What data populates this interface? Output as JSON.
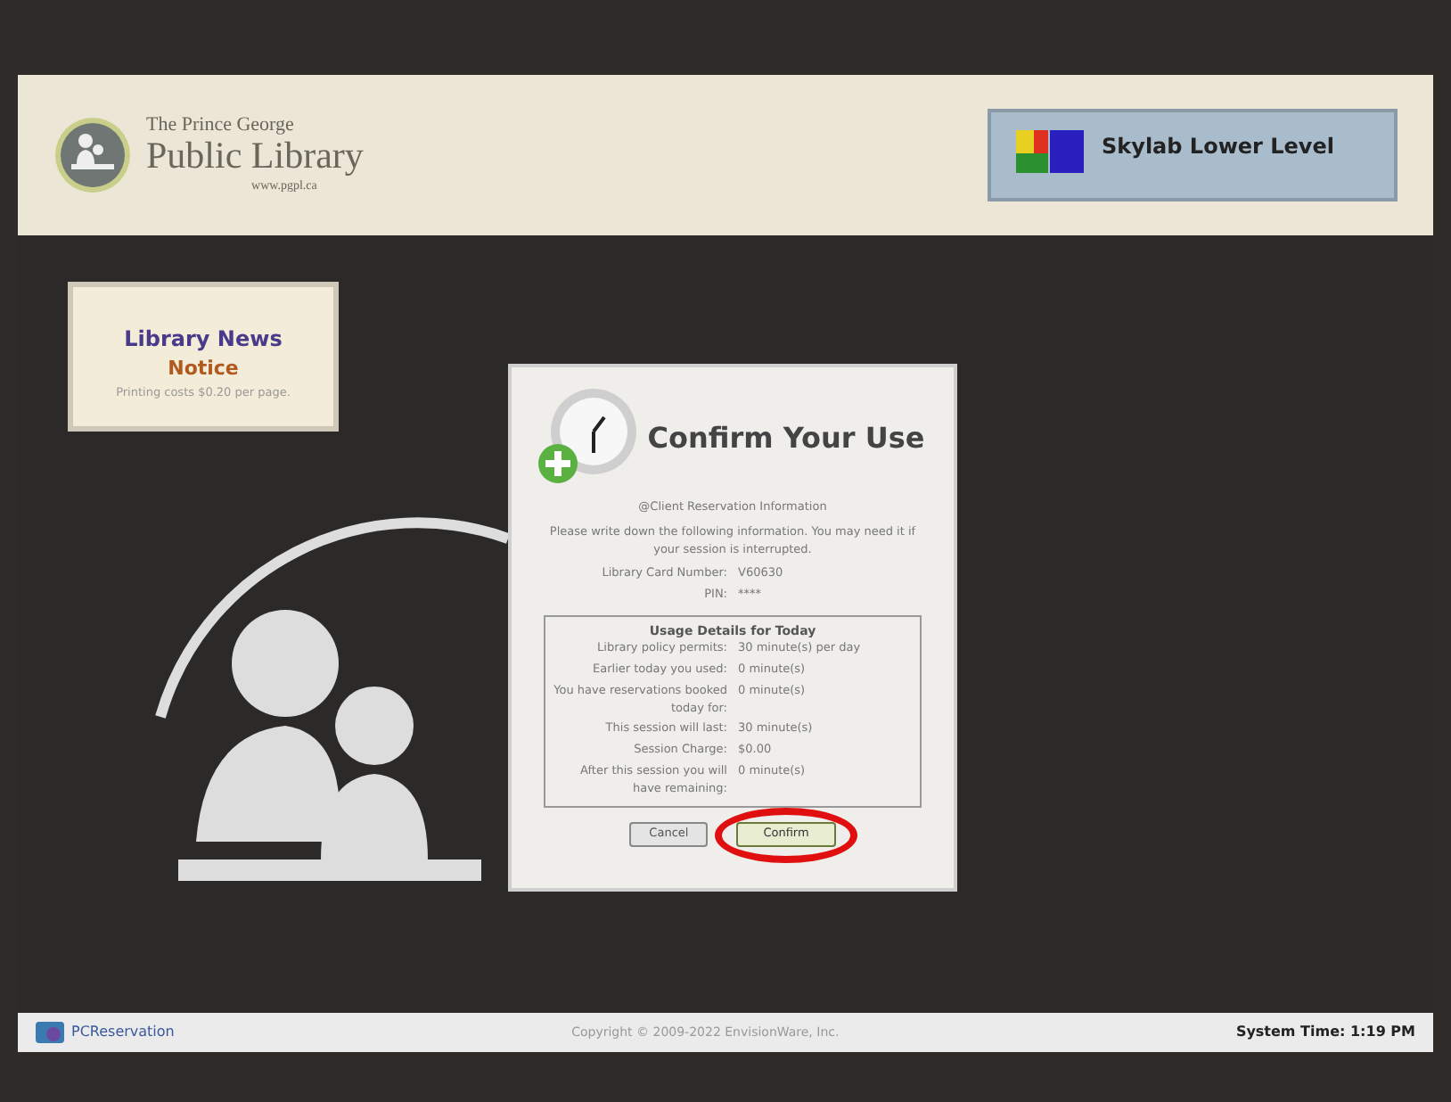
{
  "header": {
    "logo_line_1": "The Prince George",
    "logo_line_2": "Public Library",
    "logo_url": "www.pgpl.ca",
    "location": "Skylab Lower Level"
  },
  "news": {
    "title": "Library News",
    "subtitle": "Notice",
    "text": "Printing costs $0.20 per page."
  },
  "dialog": {
    "title": "Confirm Your Use",
    "section": "@Client Reservation Information",
    "instructions": "Please write down the following information. You may need it if your session is interrupted.",
    "fields": [
      {
        "label": "Library Card Number:",
        "value": "V60630"
      },
      {
        "label": "PIN:",
        "value": "****"
      }
    ],
    "usage_title": "Usage Details for Today",
    "usage": [
      {
        "label": "Library policy permits:",
        "value": "30 minute(s) per day"
      },
      {
        "label": "Earlier today you used:",
        "value": "0 minute(s)"
      },
      {
        "label": "You have reservations booked today for:",
        "value": "0 minute(s)"
      },
      {
        "label": "This session will last:",
        "value": "30 minute(s)"
      },
      {
        "label": "Session Charge:",
        "value": "$0.00"
      },
      {
        "label": "After this session you will have remaining:",
        "value": "0 minute(s)"
      }
    ],
    "buttons": [
      {
        "label": "Cancel",
        "highlighted": false
      },
      {
        "label": "Confirm",
        "highlighted": true
      }
    ]
  },
  "footer": {
    "brand": "PCReservation",
    "copyright": "Copyright © 2009-2022 EnvisionWare, Inc.",
    "system_time_label": "System Time:",
    "system_time": "1:19 PM"
  }
}
